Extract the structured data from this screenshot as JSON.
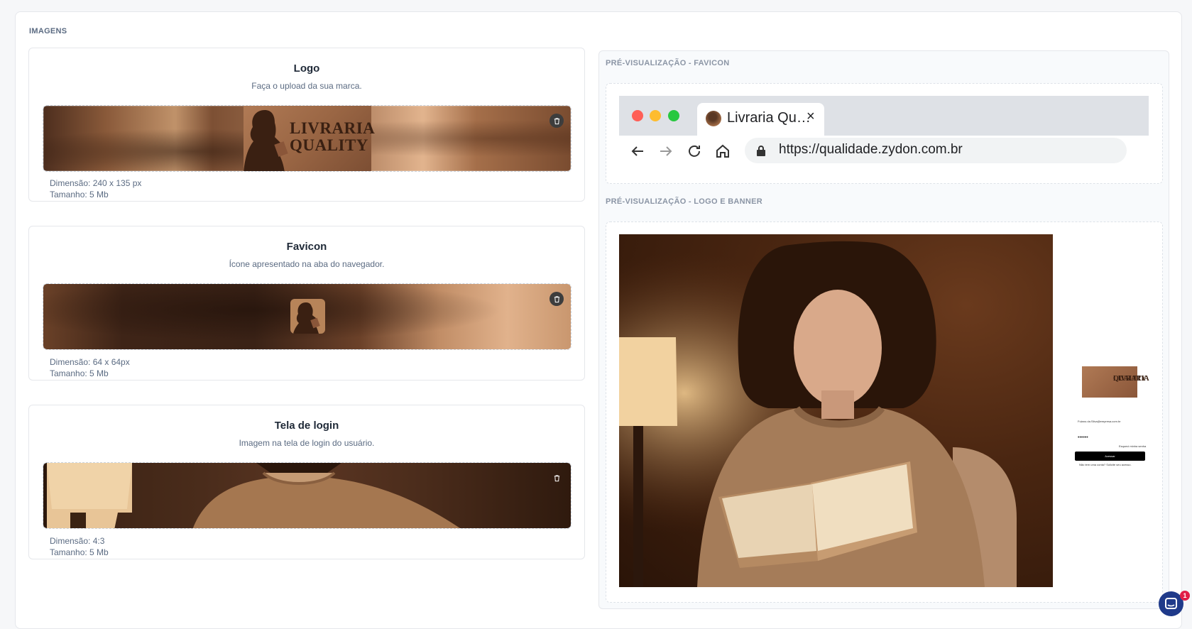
{
  "section": {
    "title": "IMAGENS"
  },
  "cards": [
    {
      "title": "Logo",
      "subtitle": "Faça o upload da sua marca.",
      "dimension": "Dimensão: 240 x 135 px",
      "size": "Tamanho: 5 Mb",
      "logo_text_line1": "LIVRARIA",
      "logo_text_line2": "QUALITY"
    },
    {
      "title": "Favicon",
      "subtitle": "Ícone apresentado na aba do navegador.",
      "dimension": "Dimensão: 64 x 64px",
      "size": "Tamanho: 5 Mb"
    },
    {
      "title": "Tela de login",
      "subtitle": "Imagem na tela de login do usuário.",
      "dimension": "Dimensão: 4:3",
      "size": "Tamanho: 5 Mb"
    }
  ],
  "preview": {
    "favicon_label": "PRÉ-VISUALIZAÇÃO - FAVICON",
    "banner_label": "PRÉ-VISUALIZAÇÃO - LOGO E BANNER",
    "tab_title": "Livraria Qu…",
    "tab_close": "×",
    "url": "https://qualidade.zydon.com.br",
    "mini_logo_line1": "LIVRARIA",
    "mini_logo_line2": "QUALITY",
    "mini_field_value": "Fulano.da.Silva@empresa.com.br",
    "mini_password": "••••••",
    "mini_forgot": "Esqueci minha senha",
    "mini_button": "Acessar",
    "mini_footer": "Não tem uma conta? Solicite seu acesso."
  },
  "chat": {
    "badge": "1"
  },
  "colors": {
    "accent": "#1f3a8a",
    "badge": "#e11d48",
    "brown": "#8a5639"
  }
}
